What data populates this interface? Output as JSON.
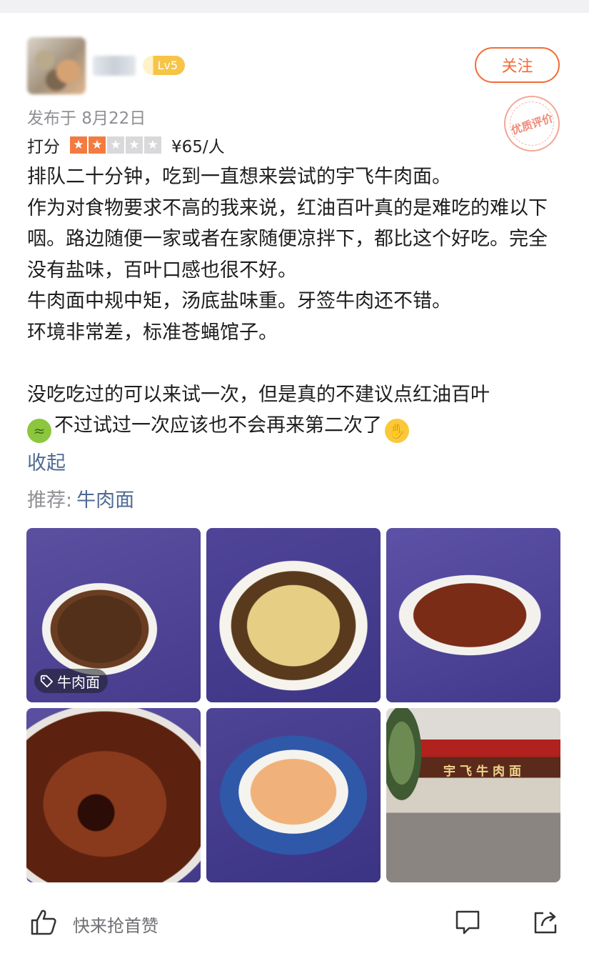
{
  "header": {
    "level_badge": "Lv5",
    "follow_label": "关注",
    "quality_stamp": "优质评价",
    "publish_date": "发布于 8月22日"
  },
  "rating": {
    "label": "打分",
    "stars_filled": 2,
    "stars_total": 5,
    "price": "¥65/人"
  },
  "review": {
    "paragraphs": [
      "排队二十分钟，吃到一直想来尝试的宇飞牛肉面。",
      "作为对食物要求不高的我来说，红油百叶真的是难吃的难以下咽。路边随便一家或者在家随便凉拌下，都比这个好吃。完全没有盐味，百叶口感也很不好。",
      "牛肉面中规中矩，汤底盐味重。牙签牛肉还不错。",
      "环境非常差，标准苍蝇馆子。",
      "没吃吃过的可以来试一次，但是真的不建议点红油百叶",
      "不过试过一次应该也不会再来第二次了"
    ],
    "emoji_sick": "nauseated-face",
    "emoji_wave": "waving-hand",
    "collapse_label": "收起"
  },
  "recommend": {
    "label": "推荐:",
    "dish": "牛肉面"
  },
  "photos": {
    "first_tag": "牛肉面",
    "shop_sign": "宇飞牛肉面"
  },
  "actions": {
    "like_text": "快来抢首赞"
  },
  "colors": {
    "accent": "#f46b36",
    "link": "#4e6a92",
    "meta": "#8f8f94",
    "star_on": "#f47b3f"
  }
}
